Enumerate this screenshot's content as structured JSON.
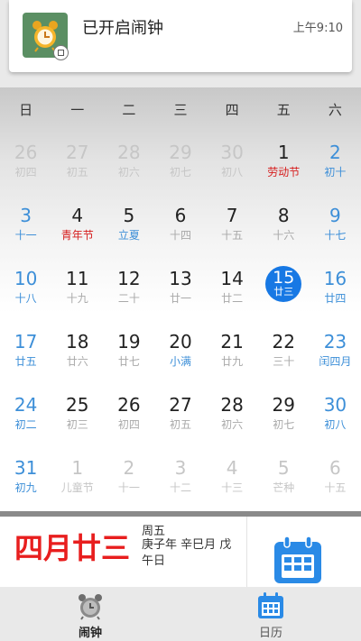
{
  "notification": {
    "title": "已开启闹钟",
    "time": "上午9:10",
    "app_icon": "alarm-clock-icon"
  },
  "calendar": {
    "weekdays": [
      "日",
      "一",
      "二",
      "三",
      "四",
      "五",
      "六"
    ],
    "colors": {
      "accent": "#1778e4",
      "weekend": "#3d8fd8",
      "festival": "#d61d1d"
    },
    "weeks": [
      [
        {
          "d": "26",
          "s": "初四",
          "t": "dim"
        },
        {
          "d": "27",
          "s": "初五",
          "t": "dim"
        },
        {
          "d": "28",
          "s": "初六",
          "t": "dim"
        },
        {
          "d": "29",
          "s": "初七",
          "t": "dim"
        },
        {
          "d": "30",
          "s": "初八",
          "t": "dim"
        },
        {
          "d": "1",
          "s": "劳动节",
          "t": "norm",
          "f": "fest"
        },
        {
          "d": "2",
          "s": "初十",
          "t": "week"
        }
      ],
      [
        {
          "d": "3",
          "s": "十一",
          "t": "week"
        },
        {
          "d": "4",
          "s": "青年节",
          "t": "norm",
          "f": "fest"
        },
        {
          "d": "5",
          "s": "立夏",
          "t": "norm",
          "f": "term"
        },
        {
          "d": "6",
          "s": "十四",
          "t": "norm"
        },
        {
          "d": "7",
          "s": "十五",
          "t": "norm"
        },
        {
          "d": "8",
          "s": "十六",
          "t": "norm"
        },
        {
          "d": "9",
          "s": "十七",
          "t": "week"
        }
      ],
      [
        {
          "d": "10",
          "s": "十八",
          "t": "week"
        },
        {
          "d": "11",
          "s": "十九",
          "t": "norm"
        },
        {
          "d": "12",
          "s": "二十",
          "t": "norm"
        },
        {
          "d": "13",
          "s": "廿一",
          "t": "norm"
        },
        {
          "d": "14",
          "s": "廿二",
          "t": "norm"
        },
        {
          "d": "15",
          "s": "廿三",
          "t": "today"
        },
        {
          "d": "16",
          "s": "廿四",
          "t": "week"
        }
      ],
      [
        {
          "d": "17",
          "s": "廿五",
          "t": "week"
        },
        {
          "d": "18",
          "s": "廿六",
          "t": "norm"
        },
        {
          "d": "19",
          "s": "廿七",
          "t": "norm"
        },
        {
          "d": "20",
          "s": "小满",
          "t": "norm",
          "f": "term"
        },
        {
          "d": "21",
          "s": "廿九",
          "t": "norm"
        },
        {
          "d": "22",
          "s": "三十",
          "t": "norm"
        },
        {
          "d": "23",
          "s": "闰四月",
          "t": "week"
        }
      ],
      [
        {
          "d": "24",
          "s": "初二",
          "t": "week"
        },
        {
          "d": "25",
          "s": "初三",
          "t": "norm"
        },
        {
          "d": "26",
          "s": "初四",
          "t": "norm"
        },
        {
          "d": "27",
          "s": "初五",
          "t": "norm"
        },
        {
          "d": "28",
          "s": "初六",
          "t": "norm"
        },
        {
          "d": "29",
          "s": "初七",
          "t": "norm"
        },
        {
          "d": "30",
          "s": "初八",
          "t": "week"
        }
      ],
      [
        {
          "d": "31",
          "s": "初九",
          "t": "week"
        },
        {
          "d": "1",
          "s": "儿童节",
          "t": "dim"
        },
        {
          "d": "2",
          "s": "十一",
          "t": "dim"
        },
        {
          "d": "3",
          "s": "十二",
          "t": "dim"
        },
        {
          "d": "4",
          "s": "十三",
          "t": "dim"
        },
        {
          "d": "5",
          "s": "芒种",
          "t": "dim"
        },
        {
          "d": "6",
          "s": "十五",
          "t": "dim"
        }
      ]
    ]
  },
  "info": {
    "lunar_date": "四月廿三",
    "weekday": "周五",
    "ganzhi": "庚子年 辛巳月 戊午日",
    "calendar_icon": "calendar-icon"
  },
  "tabs": [
    {
      "label": "闹钟",
      "icon": "alarm-clock-icon",
      "active": true
    },
    {
      "label": "日历",
      "icon": "calendar-icon",
      "active": false
    }
  ]
}
